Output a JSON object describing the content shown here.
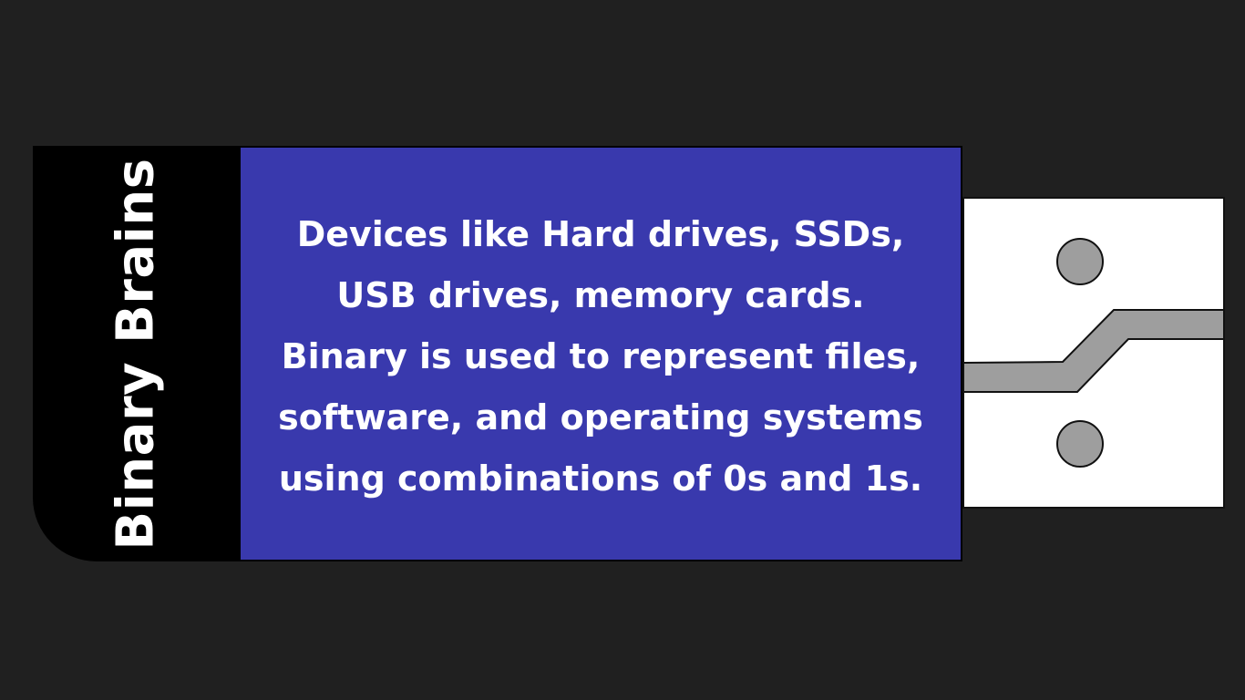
{
  "brand": {
    "name": "Binary Brains"
  },
  "label": {
    "line1": "Devices like Hard drives, SSDs,",
    "line2": "USB drives, memory cards.",
    "line3": "Binary is used to represent files,",
    "line4": "software, and operating systems",
    "line5": "using combinations of 0s and 1s."
  },
  "colors": {
    "background": "#202020",
    "panel": "#3939ad",
    "text": "#ffffff",
    "connector_trace": "#9e9e9e"
  },
  "icons": {
    "connector": "usb-connector-icon"
  }
}
